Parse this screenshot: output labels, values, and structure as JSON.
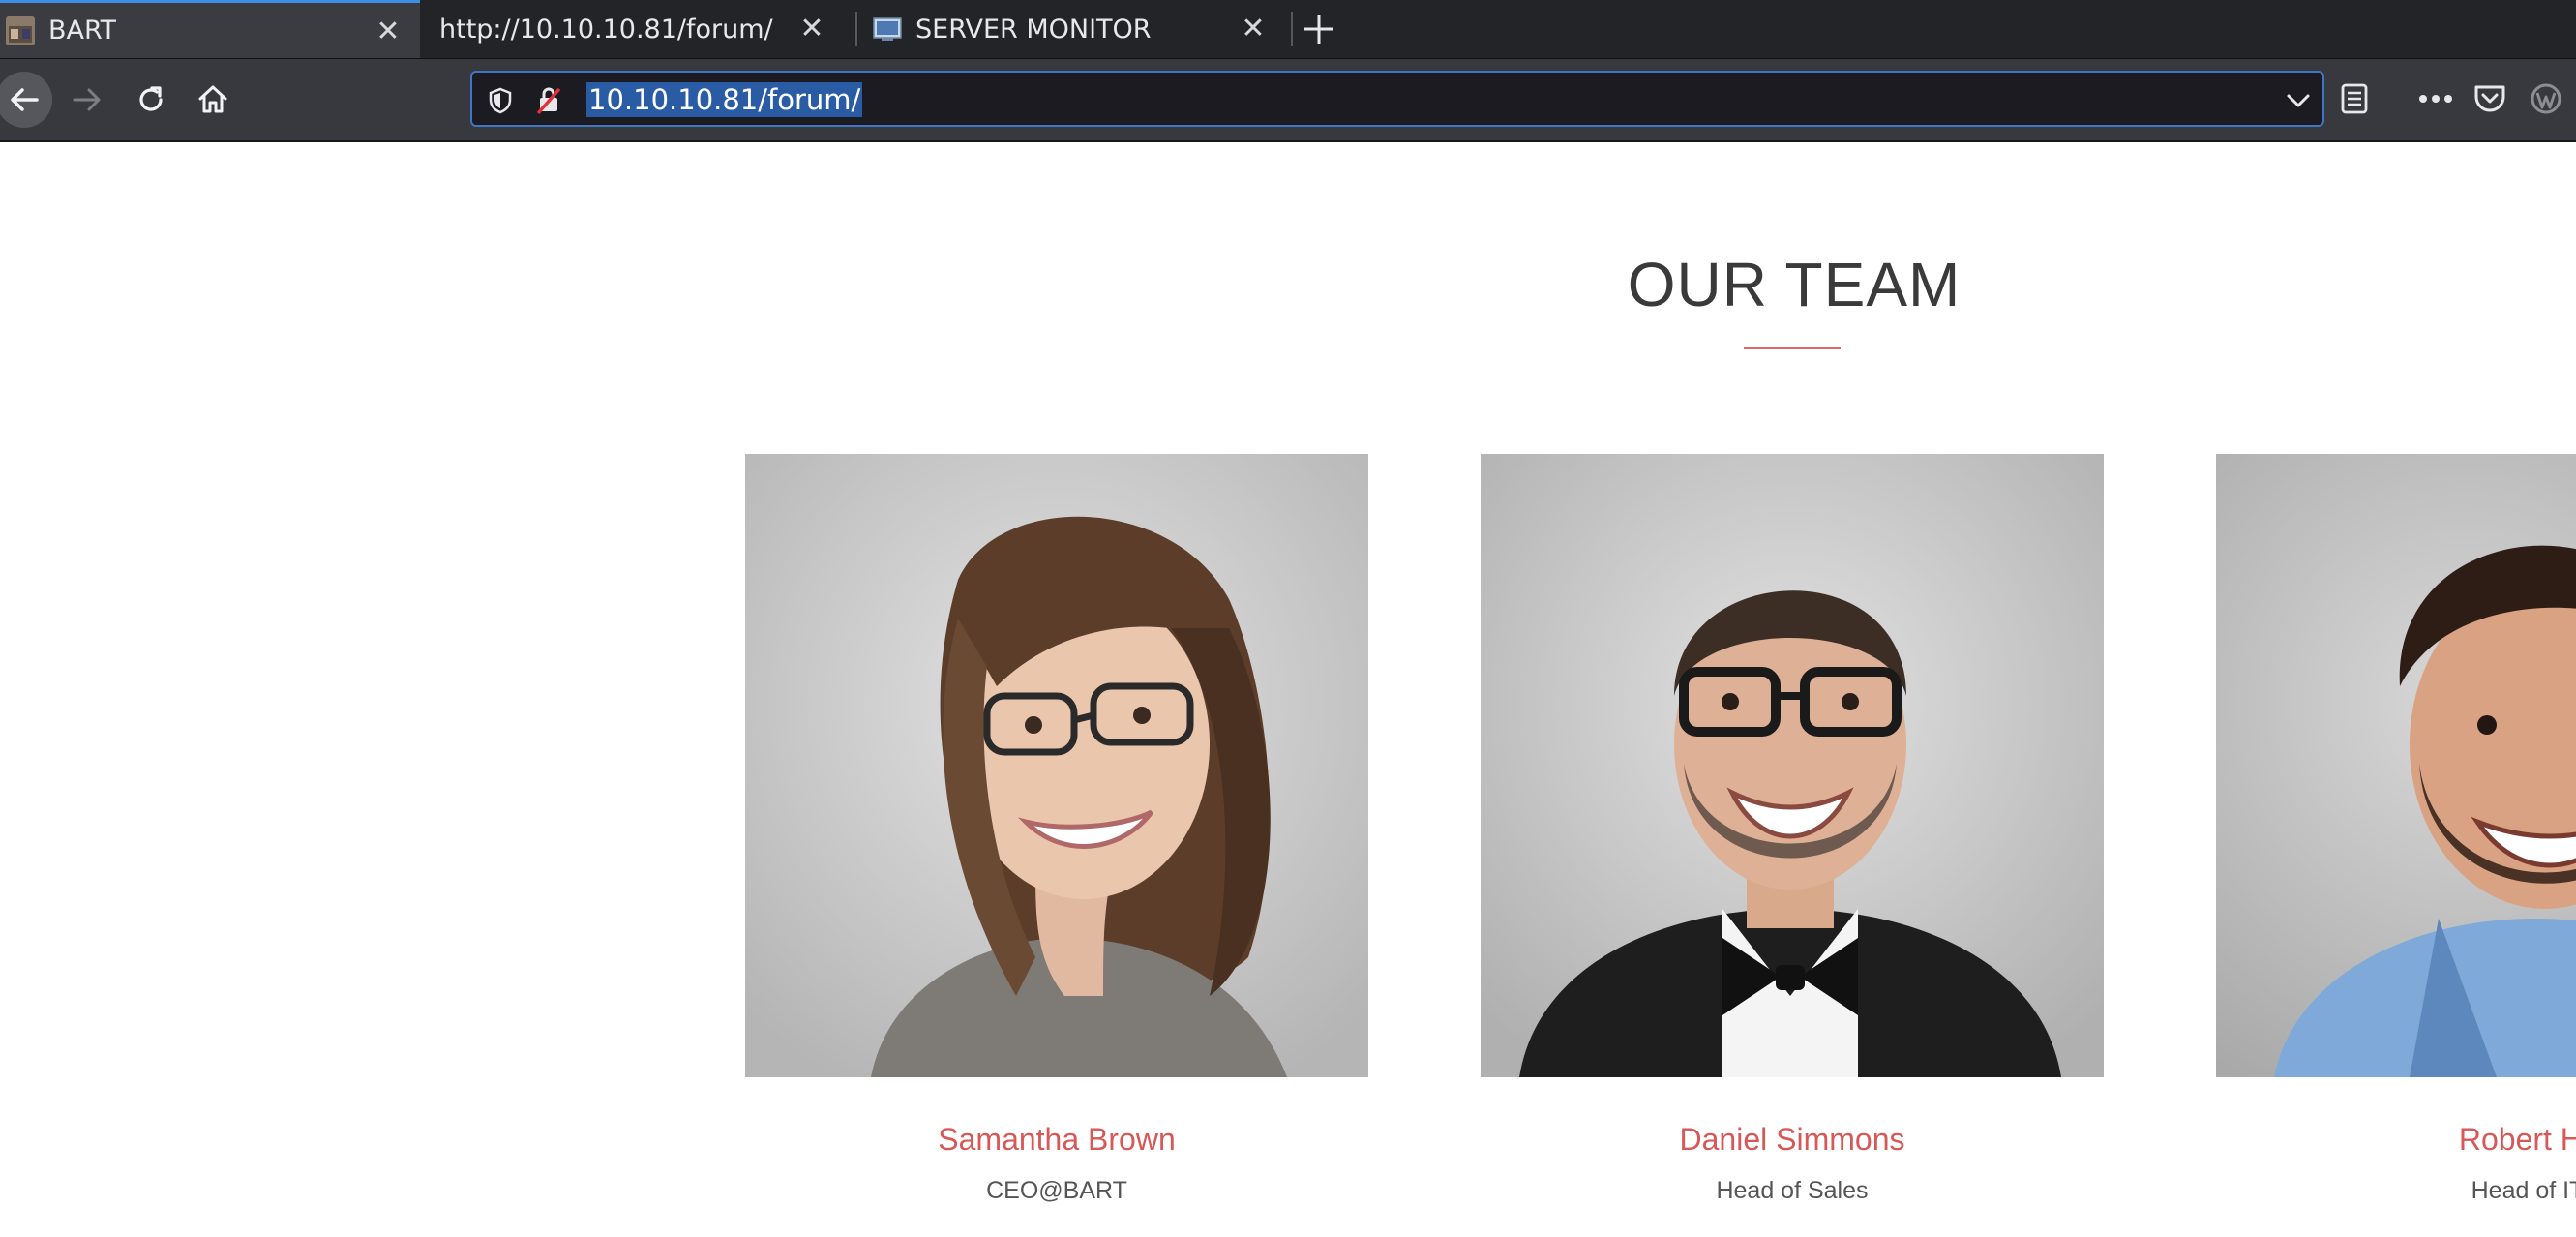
{
  "browser": {
    "tabs": [
      {
        "title": "BART",
        "active": true
      },
      {
        "title": "http://10.10.10.81/forum/",
        "active": false
      },
      {
        "title": "SERVER MONITOR",
        "active": false
      }
    ],
    "url": "10.10.10.81/forum/",
    "accent_color": "#3e8ee8"
  },
  "page": {
    "section_title": "OUR TEAM",
    "accent_color": "#d85757",
    "team": [
      {
        "name": "Samantha Brown",
        "role": "CEO@BART"
      },
      {
        "name": "Daniel Simmons",
        "role": "Head of Sales"
      },
      {
        "name": "Robert Hil",
        "role": "Head of IT"
      }
    ]
  }
}
